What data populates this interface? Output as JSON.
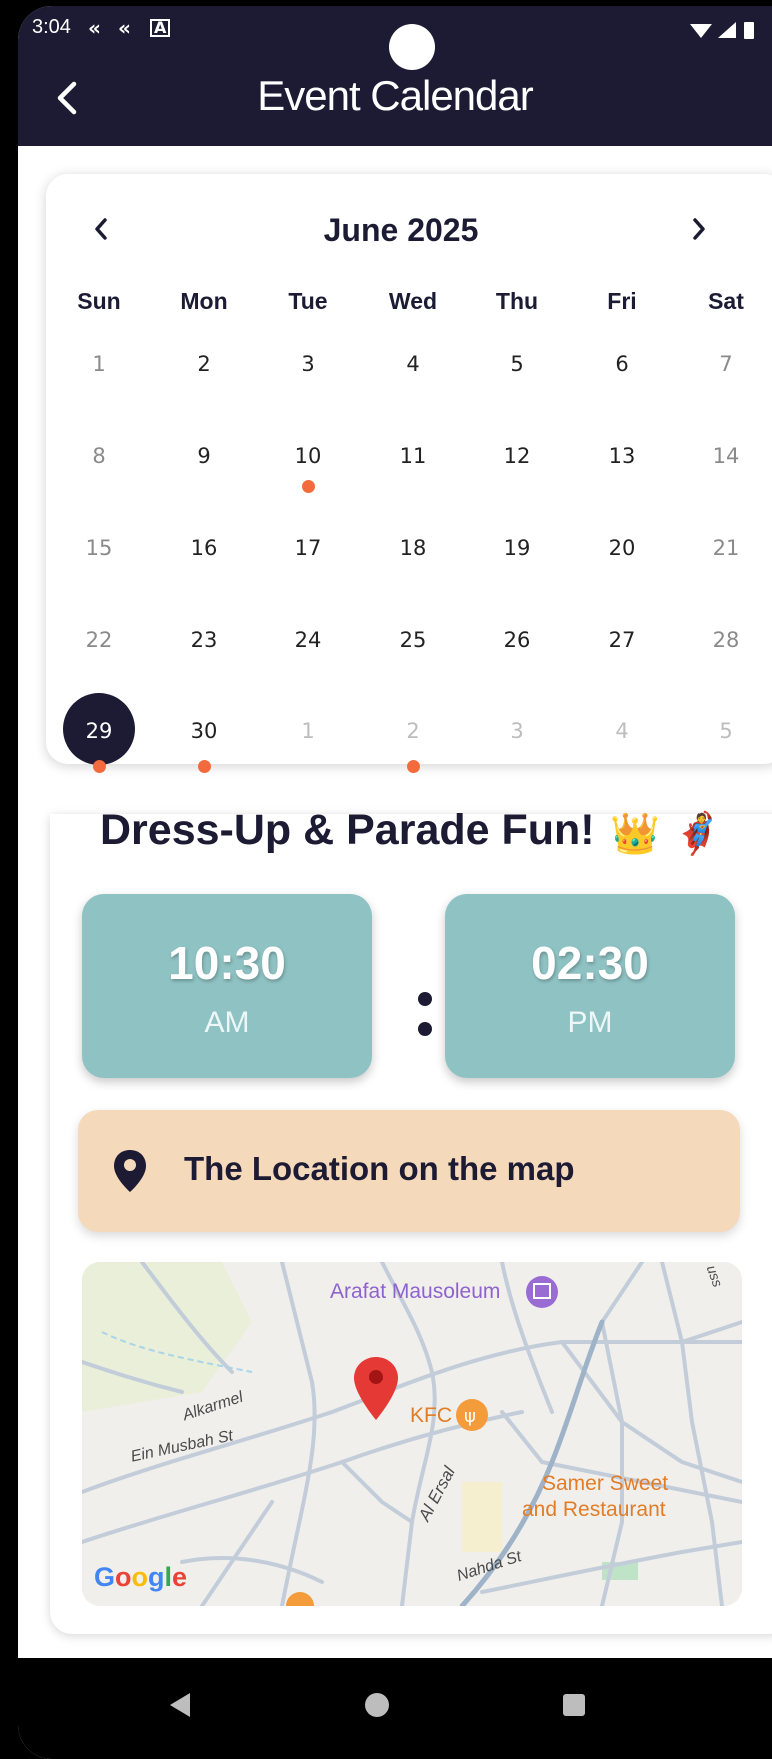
{
  "status_bar": {
    "time": "3:04"
  },
  "header": {
    "title": "Event Calendar"
  },
  "calendar": {
    "month_label": "June 2025",
    "weekdays": [
      "Sun",
      "Mon",
      "Tue",
      "Wed",
      "Thu",
      "Fri",
      "Sat"
    ],
    "weeks": [
      [
        "1",
        "2",
        "3",
        "4",
        "5",
        "6",
        "7"
      ],
      [
        "8",
        "9",
        "10",
        "11",
        "12",
        "13",
        "14"
      ],
      [
        "15",
        "16",
        "17",
        "18",
        "19",
        "20",
        "21"
      ],
      [
        "22",
        "23",
        "24",
        "25",
        "26",
        "27",
        "28"
      ],
      [
        "29",
        "30",
        "1",
        "2",
        "3",
        "4",
        "5"
      ]
    ],
    "selected_day": "29",
    "event_days": [
      "10",
      "29",
      "30",
      "2"
    ]
  },
  "event": {
    "title": "Dress-Up & Parade Fun!",
    "emojis": "👑 🦸",
    "start_time": "10:30",
    "start_period": "AM",
    "end_time": "02:30",
    "end_period": "PM",
    "location_label": "The Location on the map"
  },
  "map": {
    "labels": {
      "arafat": "Arafat Mausoleum",
      "kfc": "KFC",
      "samer1": "Samer Sweet",
      "samer2": "and Restaurant",
      "alkarmel": "Alkarmel",
      "ein": "Ein Musbah St",
      "alersal": "Al Ersal",
      "nahda": "Nahda St",
      "corner": "uss"
    },
    "logo": "Google"
  },
  "colors": {
    "primary": "#1d1b33",
    "accent_dot": "#f36b3c",
    "time_box": "#8fc2c3",
    "location_bar": "#f5d9bb",
    "map_pin": "#e53935"
  }
}
